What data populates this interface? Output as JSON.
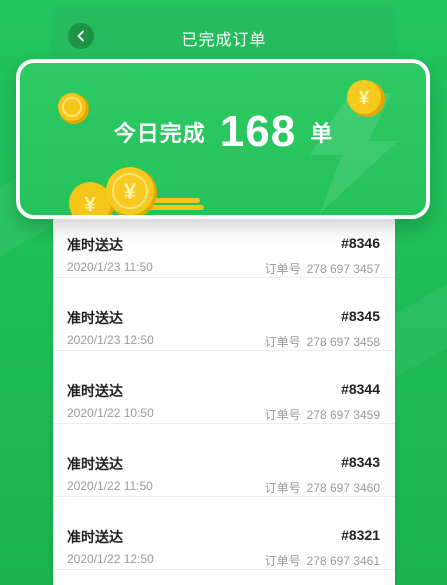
{
  "header": {
    "title": "已完成订单",
    "back_icon": "chevron-left-icon"
  },
  "summary": {
    "prefix": "今日完成",
    "count": "168",
    "suffix": "单",
    "decoration_icons": [
      "coin-yen-icon",
      "coin-stack-icon",
      "lightning-bolt-icon"
    ]
  },
  "orders": [
    {
      "status": "准时送达",
      "code": "#8346",
      "time": "2020/1/23  11:50",
      "order_no_label": "订单号",
      "order_no": "278 697 3457"
    },
    {
      "status": "准时送达",
      "code": "#8345",
      "time": "2020/1/23 12:50",
      "order_no_label": "订单号",
      "order_no": "278 697 3458"
    },
    {
      "status": "准时送达",
      "code": "#8344",
      "time": "2020/1/22 10:50",
      "order_no_label": "订单号",
      "order_no": "278 697 3459"
    },
    {
      "status": "准时送达",
      "code": "#8343",
      "time": "2020/1/22 11:50",
      "order_no_label": "订单号",
      "order_no": "278 697 3460"
    },
    {
      "status": "准时送达",
      "code": "#8321",
      "time": "2020/1/22 12:50",
      "order_no_label": "订单号",
      "order_no": "278 697 3461"
    }
  ],
  "colors": {
    "background": "#1dbb55",
    "banner": "#2dca64",
    "coin": "#f5c518",
    "text_primary": "#222222",
    "text_secondary": "#9a9a9a"
  }
}
